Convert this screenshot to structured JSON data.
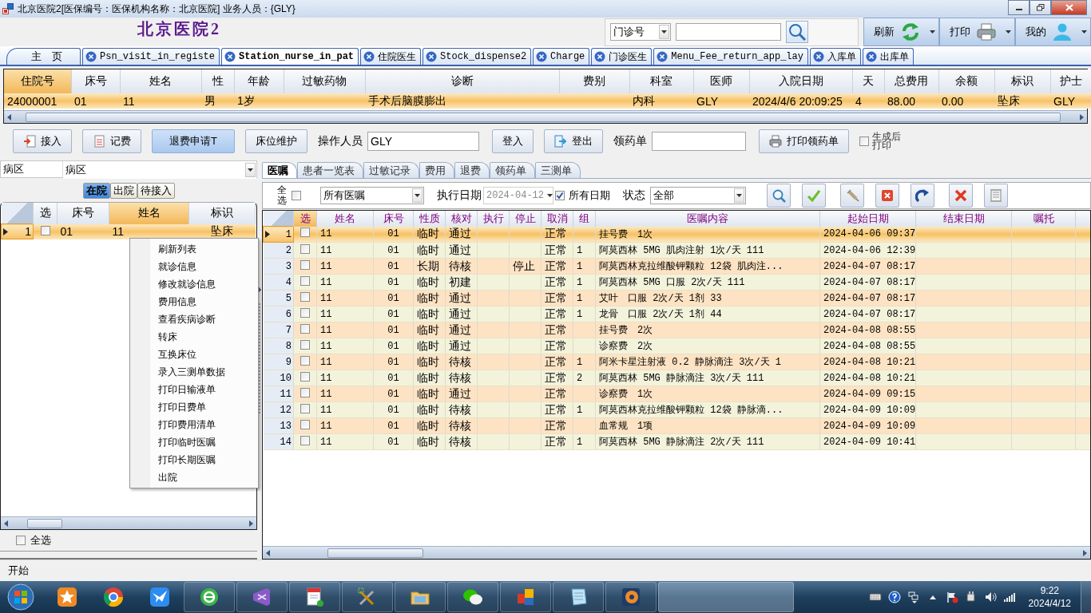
{
  "window": {
    "title": "北京医院2[医保编号：医保机构名称：北京医院]  业务人员：{GLY}"
  },
  "header": {
    "hospital_name": "北京医院2",
    "search": {
      "type": "门诊号"
    },
    "buttons": [
      {
        "label": "刷新",
        "kind": "refresh"
      },
      {
        "label": "打印",
        "kind": "print"
      },
      {
        "label": "我的",
        "kind": "user"
      }
    ]
  },
  "doc_tabs": [
    {
      "label": "主　页",
      "selected": false,
      "closable": false
    },
    {
      "label": "Psn_visit_in_registe",
      "selected": false,
      "closable": true
    },
    {
      "label": "Station_nurse_in_pat",
      "selected": true,
      "closable": true
    },
    {
      "label": "住院医生",
      "selected": false,
      "closable": true
    },
    {
      "label": "Stock_dispense2",
      "selected": false,
      "closable": true
    },
    {
      "label": "Charge",
      "selected": false,
      "closable": true
    },
    {
      "label": "门诊医生",
      "selected": false,
      "closable": true
    },
    {
      "label": "Menu_Fee_return_app_lay",
      "selected": false,
      "closable": true
    },
    {
      "label": "入库单",
      "selected": false,
      "closable": true
    },
    {
      "label": "出库单",
      "selected": false,
      "closable": true
    }
  ],
  "patient_grid": {
    "columns": [
      {
        "label": "住院号",
        "kind": "text",
        "highlighted": true
      },
      {
        "label": "床号",
        "kind": "text",
        "highlighted": false
      },
      {
        "label": "姓名",
        "kind": "text",
        "highlighted": false
      },
      {
        "label": "性",
        "kind": "text",
        "highlighted": false
      },
      {
        "label": "年龄",
        "kind": "text",
        "highlighted": false
      },
      {
        "label": "过敏药物",
        "kind": "text",
        "highlighted": false
      },
      {
        "label": "诊断",
        "kind": "text",
        "highlighted": false
      },
      {
        "label": "费别",
        "kind": "text",
        "highlighted": false
      },
      {
        "label": "科室",
        "kind": "text",
        "highlighted": false
      },
      {
        "label": "医师",
        "kind": "text",
        "highlighted": false
      },
      {
        "label": "入院日期",
        "kind": "text",
        "highlighted": false
      },
      {
        "label": "天",
        "kind": "text",
        "highlighted": false
      },
      {
        "label": "总费用",
        "kind": "text",
        "highlighted": false
      },
      {
        "label": "余额",
        "kind": "text",
        "highlighted": false
      },
      {
        "label": "标识",
        "kind": "text",
        "highlighted": false
      },
      {
        "label": "护士",
        "kind": "text",
        "highlighted": false
      }
    ],
    "rows": [
      {
        "selected": true,
        "cells": [
          "24000001",
          "01",
          "11",
          "男",
          "1岁",
          null,
          "手术后脑膜膨出",
          null,
          "内科",
          "GLY",
          "2024/4/6 20:09:25",
          "4",
          "88.00",
          "0.00",
          "坠床",
          "GLY"
        ]
      }
    ]
  },
  "toolbar": [
    {
      "kind": "button",
      "label": "接入",
      "highlighted": false
    },
    {
      "kind": "button",
      "label": "记费",
      "highlighted": false
    },
    {
      "kind": "button",
      "label": "退费申请T",
      "highlighted": true
    },
    {
      "kind": "button",
      "label": "床位维护",
      "highlighted": false
    },
    {
      "kind": "label",
      "label": "操作人员"
    },
    {
      "kind": "field",
      "value": "GLY"
    },
    {
      "kind": "button",
      "label": "登入",
      "highlighted": false
    },
    {
      "kind": "button",
      "label": "登出",
      "highlighted": false
    },
    {
      "kind": "label",
      "label": "领药单"
    },
    {
      "kind": "field"
    },
    {
      "kind": "button",
      "label": "打印领药单",
      "highlighted": false
    },
    {
      "kind": "checkbox",
      "label": "生成后打印",
      "checked": false
    }
  ],
  "left_panel": {
    "ward_label": "病区",
    "ward": "病区",
    "filter_tabs": [
      {
        "label": "在院",
        "selected": true
      },
      {
        "label": "出院",
        "selected": false
      },
      {
        "label": "待接入",
        "selected": false
      }
    ],
    "grid": {
      "columns": [
        {
          "label": "选",
          "kind": "checkbox",
          "highlighted": false
        },
        {
          "label": "床号",
          "kind": "text",
          "highlighted": false
        },
        {
          "label": "姓名",
          "kind": "text",
          "highlighted": true
        },
        {
          "label": "标识",
          "kind": "text",
          "highlighted": false
        }
      ],
      "rows": [
        {
          "number": "1",
          "selected": true,
          "checked": false,
          "cells": [
            null,
            "01",
            "11",
            "坠床"
          ]
        }
      ]
    },
    "select_all": {
      "label": "全选",
      "checked": false
    }
  },
  "context_menu": {
    "items": [
      "刷新列表",
      "就诊信息",
      "修改就诊信息",
      "费用信息",
      "查看疾病诊断",
      "转床",
      "互换床位",
      "录入三测单数据",
      "打印日输液单",
      "打印日费单",
      "打印费用清单",
      "打印临时医嘱",
      "打印长期医嘱",
      "出院"
    ]
  },
  "right_panel": {
    "tabs": [
      {
        "label": "医嘱",
        "selected": true
      },
      {
        "label": "患者一览表",
        "selected": false
      },
      {
        "label": "过敏记录",
        "selected": false
      },
      {
        "label": "费用",
        "selected": false
      },
      {
        "label": "退费",
        "selected": false
      },
      {
        "label": "领药单",
        "selected": false
      },
      {
        "label": "三测单",
        "selected": false
      }
    ],
    "toolbar": {
      "select_all": {
        "label": "全选",
        "checked": false
      },
      "order_filter": "所有医嘱",
      "exec_date_label": "执行日期",
      "exec_date": {
        "value": "2024-04-12",
        "disabled": true
      },
      "all_dates": {
        "label": "所有日期",
        "checked": true
      },
      "status_label": "状态",
      "status": "全部"
    },
    "grid": {
      "columns": [
        {
          "label": "选",
          "kind": "checkbox",
          "highlighted": true
        },
        {
          "label": "姓名",
          "kind": "text",
          "highlighted": false
        },
        {
          "label": "床号",
          "kind": "text",
          "highlighted": false
        },
        {
          "label": "性质",
          "kind": "text",
          "highlighted": false
        },
        {
          "label": "核对",
          "kind": "text",
          "highlighted": false
        },
        {
          "label": "执行",
          "kind": "text",
          "highlighted": false
        },
        {
          "label": "停止",
          "kind": "text",
          "highlighted": false
        },
        {
          "label": "取消",
          "kind": "text",
          "highlighted": false
        },
        {
          "label": "组",
          "kind": "text",
          "highlighted": false
        },
        {
          "label": "医嘱内容",
          "kind": "text",
          "highlighted": false
        },
        {
          "label": "起始日期",
          "kind": "text",
          "highlighted": false
        },
        {
          "label": "结束日期",
          "kind": "text",
          "highlighted": false
        },
        {
          "label": "嘱托",
          "kind": "text",
          "highlighted": false
        },
        {
          "kind": "text",
          "highlighted": false
        }
      ],
      "rows": [
        {
          "number": "1",
          "selected": true,
          "checked": false,
          "cells": [
            null,
            "11",
            "01",
            "临时",
            "通过",
            null,
            null,
            "正常",
            null,
            "挂号费　1次",
            "2024-04-06 09:37"
          ]
        },
        {
          "number": "2",
          "selected": false,
          "checked": false,
          "cells": [
            null,
            "11",
            "01",
            "临时",
            "通过",
            null,
            null,
            "正常",
            "1",
            "阿莫西林 5MG 肌肉注射 1次/天 111",
            "2024-04-06 12:39"
          ]
        },
        {
          "number": "3",
          "selected": false,
          "checked": false,
          "cells": [
            null,
            "11",
            "01",
            "长期",
            "待核",
            null,
            "停止",
            "正常",
            "1",
            "阿莫西林克拉维酸钾颗粒 12袋 肌肉注...",
            "2024-04-07 08:17"
          ]
        },
        {
          "number": "4",
          "selected": false,
          "checked": false,
          "cells": [
            null,
            "11",
            "01",
            "临时",
            "初建",
            null,
            null,
            "正常",
            "1",
            "阿莫西林 5MG 口服 2次/天 111",
            "2024-04-07 08:17"
          ]
        },
        {
          "number": "5",
          "selected": false,
          "checked": false,
          "cells": [
            null,
            "11",
            "01",
            "临时",
            "通过",
            null,
            null,
            "正常",
            "1",
            "艾叶　口服 2次/天 1剂 33",
            "2024-04-07 08:17"
          ]
        },
        {
          "number": "6",
          "selected": false,
          "checked": false,
          "cells": [
            null,
            "11",
            "01",
            "临时",
            "通过",
            null,
            null,
            "正常",
            "1",
            "龙骨　口服 2次/天 1剂 44",
            "2024-04-07 08:17"
          ]
        },
        {
          "number": "7",
          "selected": false,
          "checked": false,
          "cells": [
            null,
            "11",
            "01",
            "临时",
            "通过",
            null,
            null,
            "正常",
            null,
            "挂号费　2次",
            "2024-04-08 08:55"
          ]
        },
        {
          "number": "8",
          "selected": false,
          "checked": false,
          "cells": [
            null,
            "11",
            "01",
            "临时",
            "通过",
            null,
            null,
            "正常",
            null,
            "诊察费　2次",
            "2024-04-08 08:55"
          ]
        },
        {
          "number": "9",
          "selected": false,
          "checked": false,
          "cells": [
            null,
            "11",
            "01",
            "临时",
            "待核",
            null,
            null,
            "正常",
            "1",
            "阿米卡星注射液 0.2 静脉滴注 3次/天 1",
            "2024-04-08 10:21"
          ]
        },
        {
          "number": "10",
          "selected": false,
          "checked": false,
          "cells": [
            null,
            "11",
            "01",
            "临时",
            "待核",
            null,
            null,
            "正常",
            "2",
            "阿莫西林 5MG 静脉滴注 3次/天 111",
            "2024-04-08 10:21"
          ]
        },
        {
          "number": "11",
          "selected": false,
          "checked": false,
          "cells": [
            null,
            "11",
            "01",
            "临时",
            "通过",
            null,
            null,
            "正常",
            null,
            "诊察费　1次",
            "2024-04-09 09:15"
          ]
        },
        {
          "number": "12",
          "selected": false,
          "checked": false,
          "cells": [
            null,
            "11",
            "01",
            "临时",
            "待核",
            null,
            null,
            "正常",
            "1",
            "阿莫西林克拉维酸钾颗粒 12袋 静脉滴...",
            "2024-04-09 10:09"
          ]
        },
        {
          "number": "13",
          "selected": false,
          "checked": false,
          "cells": [
            null,
            "11",
            "01",
            "临时",
            "待核",
            null,
            null,
            "正常",
            null,
            "血常规　1项",
            "2024-04-09 10:09"
          ]
        },
        {
          "number": "14",
          "selected": false,
          "checked": false,
          "cells": [
            null,
            "11",
            "01",
            "临时",
            "待核",
            null,
            null,
            "正常",
            "1",
            "阿莫西林 5MG 静脉滴注 2次/天 111",
            "2024-04-09 10:41"
          ]
        }
      ]
    }
  },
  "status_bar": {
    "text": "开始"
  },
  "taskbar": {
    "time": "9:22",
    "date": "2024/4/12"
  }
}
